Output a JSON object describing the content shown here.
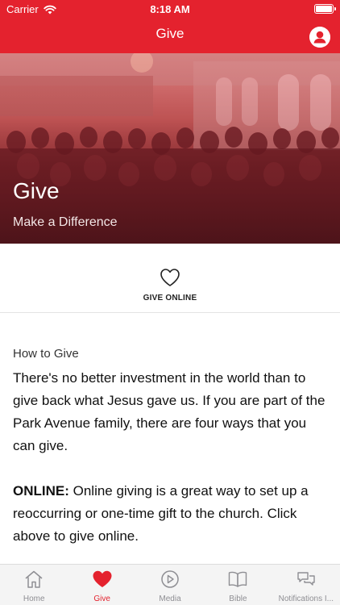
{
  "status_bar": {
    "carrier": "Carrier",
    "time": "8:18 AM"
  },
  "nav": {
    "title": "Give",
    "profile_icon": "person-circle-icon"
  },
  "hero": {
    "title": "Give",
    "subtitle": "Make a Difference"
  },
  "give_online": {
    "label": "GIVE ONLINE",
    "icon": "heart-outline-icon"
  },
  "content": {
    "section_title": "How to Give",
    "paragraph1": "There's no better investment in the world than to give back what Jesus gave us. If you are part of the Park Avenue family, there are four ways that you can give.",
    "online_label": "ONLINE:",
    "online_text": " Online giving is a great way to set up a reoccurring or one-time gift to the church. Click above to give online."
  },
  "tabs": [
    {
      "label": "Home",
      "icon": "house-icon",
      "active": false
    },
    {
      "label": "Give",
      "icon": "heart-filled-icon",
      "active": true
    },
    {
      "label": "Media",
      "icon": "play-circle-icon",
      "active": false
    },
    {
      "label": "Bible",
      "icon": "book-icon",
      "active": false
    },
    {
      "label": "Notifications I...",
      "icon": "chat-bubbles-icon",
      "active": false
    }
  ],
  "colors": {
    "brand_red": "#e4222e",
    "inactive_tab": "#8e8e93",
    "tabbar_bg": "#f4f4f4"
  }
}
